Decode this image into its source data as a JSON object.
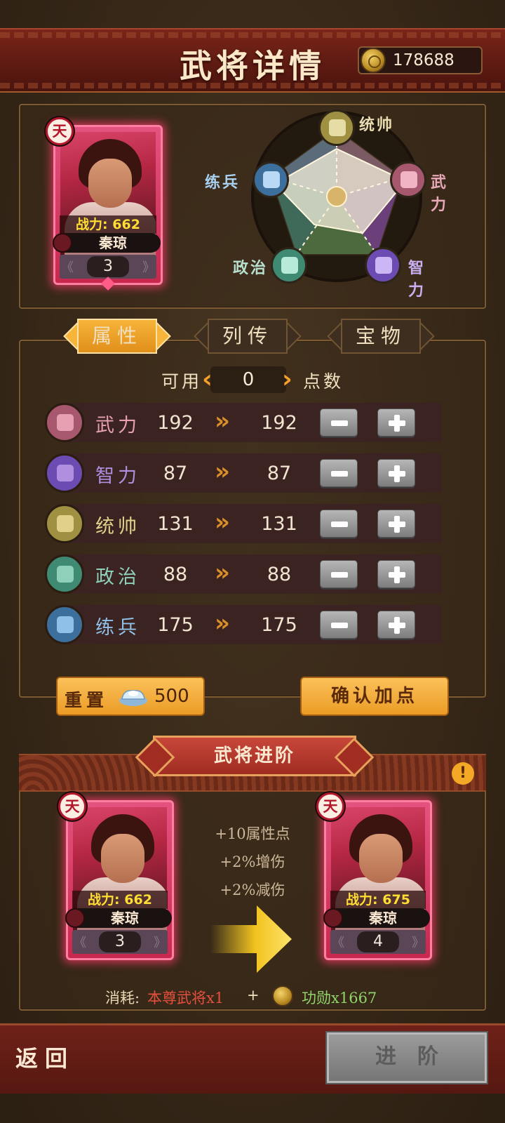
{
  "header": {
    "title": "武将详情",
    "currency_icon": "gold-coin-icon",
    "currency_value": "178688"
  },
  "general": {
    "tier": "天",
    "power_label": "战力:",
    "power_value": "662",
    "name": "秦琼",
    "rank": "3"
  },
  "radar": {
    "labels": {
      "tongshuai": "统帅",
      "wuli": "武力",
      "zhili": "智力",
      "zhengzhi": "政治",
      "lianbing": "练兵"
    },
    "icons": [
      "flag-icon",
      "fist-icon",
      "brain-icon",
      "scroll-icon",
      "armor-icon"
    ]
  },
  "tabs": [
    {
      "label": "属性",
      "active": true
    },
    {
      "label": "列传",
      "active": false
    },
    {
      "label": "宝物",
      "active": false
    }
  ],
  "points": {
    "prefix": "可用",
    "value": "0",
    "suffix": "点数"
  },
  "stats": [
    {
      "name": "武力",
      "current": "192",
      "next": "192",
      "color": "#e7a0b2",
      "icon_bg": "#a7586f",
      "icon": "fist-icon"
    },
    {
      "name": "智力",
      "current": "87",
      "next": "87",
      "color": "#b08fe0",
      "icon_bg": "#6c4cb2",
      "icon": "brain-icon"
    },
    {
      "name": "统帅",
      "current": "131",
      "next": "131",
      "color": "#e0d08a",
      "icon_bg": "#9f9042",
      "icon": "flag-icon"
    },
    {
      "name": "政治",
      "current": "88",
      "next": "88",
      "color": "#8fd0bb",
      "icon_bg": "#3f8a73",
      "icon": "scroll-icon"
    },
    {
      "name": "练兵",
      "current": "175",
      "next": "175",
      "color": "#8fc0e8",
      "icon_bg": "#3c6f9c",
      "icon": "armor-icon"
    }
  ],
  "actions": {
    "reset_label": "重置",
    "reset_cost": "500",
    "reset_icon": "silver-ingot-icon",
    "confirm_label": "确认加点"
  },
  "advance": {
    "title": "武将进阶",
    "gains": [
      "+10属性点",
      "+2%增伤",
      "+2%减伤"
    ],
    "before": {
      "tier": "天",
      "power_label": "战力:",
      "power_value": "662",
      "name": "秦琼",
      "rank": "3"
    },
    "after": {
      "tier": "天",
      "power_label": "战力:",
      "power_value": "675",
      "name": "秦琼",
      "rank": "4"
    },
    "cost_label": "消耗:",
    "cost_item": "本尊武将x1",
    "plus": "+",
    "cost_currency": "功勋x1667"
  },
  "footer": {
    "back_label": "返回",
    "advance_label": "进阶"
  },
  "colors": {
    "accent_orange": "#f7b43a",
    "header_red": "#6e2118",
    "card_pink": "#e4537f",
    "power_yellow": "#ffdd33"
  }
}
